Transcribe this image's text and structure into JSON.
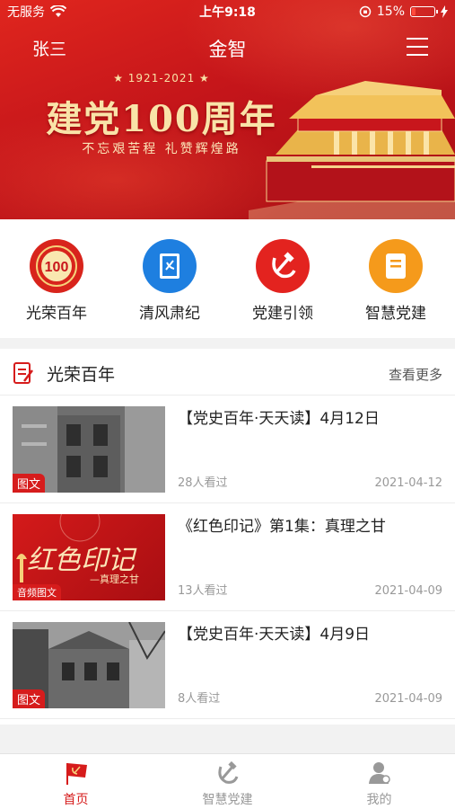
{
  "status_bar": {
    "carrier": "无服务",
    "time": "上午9:18",
    "battery": "15%",
    "battery_level": 0.15
  },
  "header": {
    "user_name": "张三",
    "app_title": "金智",
    "menu_icon": "hamburger-icon"
  },
  "banner": {
    "years": "★ 1921-2021 ★",
    "headline": "建党100周年",
    "subline": "不忘艰苦程  礼赞辉煌路",
    "colors": {
      "red": "#c4151a",
      "gold": "#f9e3a8"
    }
  },
  "quick_entries": [
    {
      "label": "光荣百年",
      "icon": "centenary-badge-icon",
      "color": "#d8241c"
    },
    {
      "label": "清风肃纪",
      "icon": "party-book-icon",
      "color": "#1e7fe0"
    },
    {
      "label": "党建引领",
      "icon": "hammer-sickle-icon",
      "color": "#e3231f"
    },
    {
      "label": "智慧党建",
      "icon": "document-icon",
      "color": "#f59a1b"
    }
  ],
  "section": {
    "title": "光荣百年",
    "more_label": "查看更多",
    "items": [
      {
        "title": "【党史百年·天天读】4月12日",
        "tag": "图文",
        "views": "28人看过",
        "date": "2021-04-12"
      },
      {
        "title": "《红色印记》第1集：真理之甘",
        "tag": "音频图文",
        "views": "13人看过",
        "date": "2021-04-09",
        "thumb_title": "红色印记",
        "thumb_sub": "—真理之甘"
      },
      {
        "title": "【党史百年·天天读】4月9日",
        "tag": "图文",
        "views": "8人看过",
        "date": "2021-04-09"
      }
    ]
  },
  "tabbar": {
    "tabs": [
      {
        "label": "首页",
        "icon": "party-flag-icon",
        "active": true
      },
      {
        "label": "智慧党建",
        "icon": "hammer-sickle-icon",
        "active": false
      },
      {
        "label": "我的",
        "icon": "user-profile-icon",
        "active": false
      }
    ],
    "active_color": "#d61c1c",
    "inactive_color": "#999999"
  }
}
